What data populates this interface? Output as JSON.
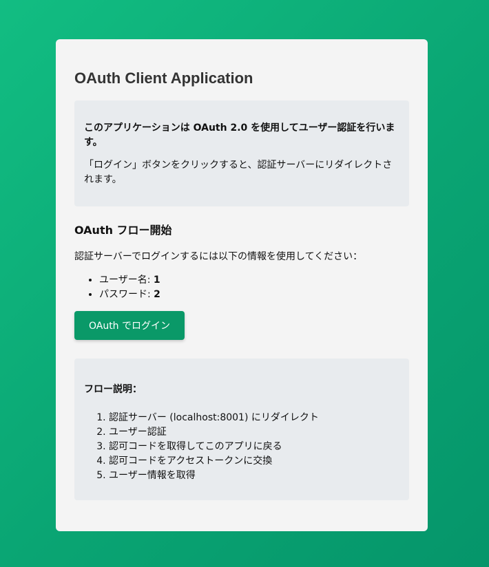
{
  "page": {
    "title": "OAuth Client Application"
  },
  "info": {
    "bold_text": "このアプリケーションは OAuth 2.0 を使用してユーザー認証を行います。",
    "text": "「ログイン」ボタンをクリックすると、認証サーバーにリダイレクトされます。"
  },
  "flow_start": {
    "title": "OAuth フロー開始",
    "instruction": "認証サーバーでログインするには以下の情報を使用してください：",
    "credentials": [
      {
        "label": "ユーザー名: ",
        "value": "1"
      },
      {
        "label": "パスワード: ",
        "value": "2"
      }
    ],
    "login_button": "OAuth でログイン"
  },
  "flow_explanation": {
    "title": "フロー説明：",
    "steps": [
      "認証サーバー (localhost:8001) にリダイレクト",
      "ユーザー認証",
      "認可コードを取得してこのアプリに戻る",
      "認可コードをアクセストークンに交換",
      "ユーザー情報を取得"
    ]
  },
  "colors": {
    "background_start": "#12bd82",
    "background_end": "#05956a",
    "card": "#f4f4f4",
    "info_box": "#e8ebee",
    "button": "#0a9968",
    "title_text": "#333333"
  }
}
